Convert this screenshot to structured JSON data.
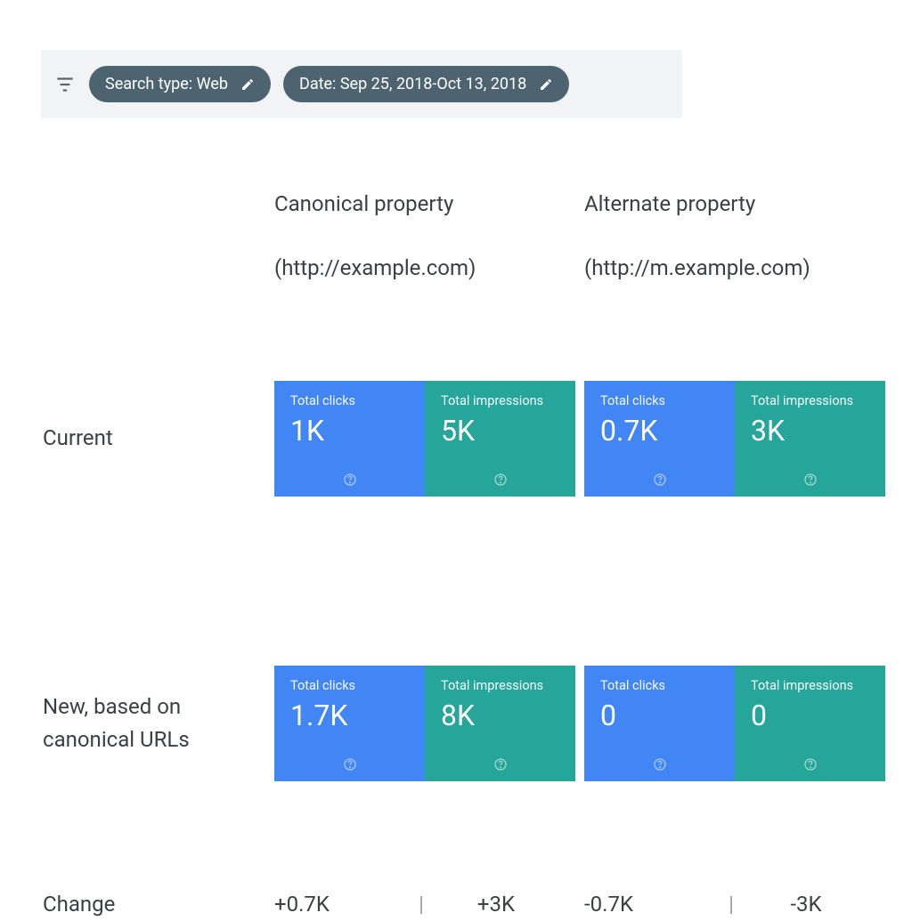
{
  "filters": {
    "search_type_label": "Search type: Web",
    "date_label": "Date: Sep 25, 2018-Oct 13, 2018"
  },
  "columns": {
    "canonical": {
      "title": "Canonical property",
      "subtitle": "(http://example.com)"
    },
    "alternate": {
      "title": "Alternate property",
      "subtitle": "(http://m.example.com)"
    }
  },
  "metric_labels": {
    "clicks": "Total clicks",
    "impressions": "Total impressions"
  },
  "rows": {
    "current": {
      "label": "Current",
      "canonical": {
        "clicks": "1K",
        "impressions": "5K"
      },
      "alternate": {
        "clicks": "0.7K",
        "impressions": "3K"
      }
    },
    "new": {
      "label": "New, based on canonical URLs",
      "canonical": {
        "clicks": "1.7K",
        "impressions": "8K"
      },
      "alternate": {
        "clicks": "0",
        "impressions": "0"
      }
    },
    "change": {
      "label": "Change",
      "canonical": {
        "clicks": "+0.7K",
        "impressions": "+3K"
      },
      "alternate": {
        "clicks": "-0.7K",
        "impressions": "-3K"
      },
      "separator": "|"
    }
  }
}
